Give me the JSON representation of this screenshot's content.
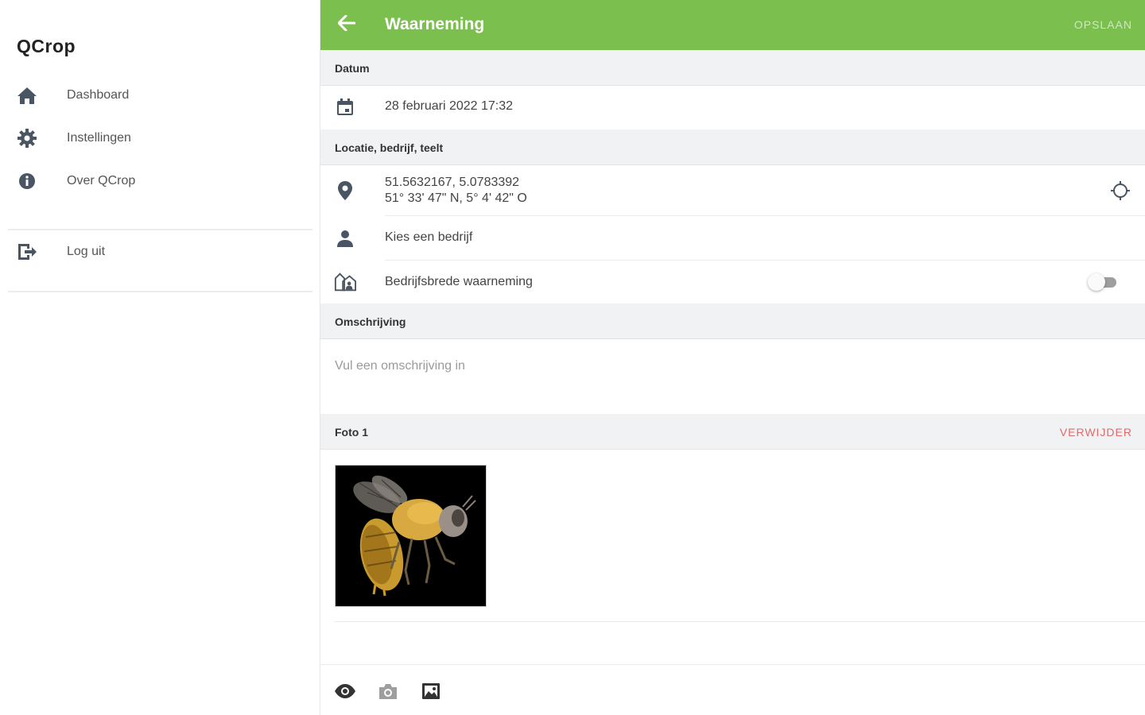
{
  "sidebar": {
    "title": "QCrop",
    "items": [
      {
        "label": "Dashboard",
        "icon": "home-icon"
      },
      {
        "label": "Instellingen",
        "icon": "gear-icon"
      },
      {
        "label": "Over QCrop",
        "icon": "info-icon"
      }
    ],
    "logout": {
      "label": "Log uit",
      "icon": "logout-icon"
    }
  },
  "header": {
    "title": "Waarneming",
    "save_label": "OPSLAAN",
    "accent_color": "#7bbf4e"
  },
  "sections": {
    "date": {
      "title": "Datum",
      "value": "28 februari 2022 17:32"
    },
    "location": {
      "title": "Locatie, bedrijf, teelt",
      "coords": "51.5632167, 5.0783392",
      "coords_dms": "51° 33' 47\" N, 5° 4' 42\" O",
      "company_placeholder": "Kies een bedrijf",
      "company_wide_label": "Bedrijfsbrede waarneming",
      "company_wide_enabled": false
    },
    "description": {
      "title": "Omschrijving",
      "placeholder": "Vul een omschrijving in"
    },
    "photo": {
      "title": "Foto 1",
      "delete_label": "VERWIJDER"
    }
  },
  "bottom_bar": {
    "icons": [
      "eye-icon",
      "camera-icon",
      "gallery-icon"
    ]
  }
}
